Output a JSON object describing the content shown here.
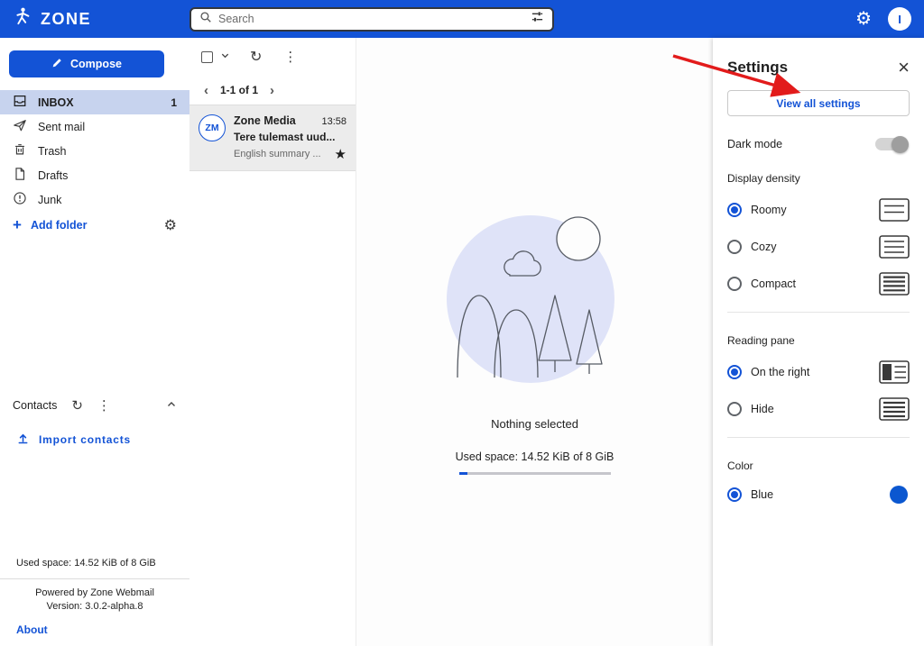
{
  "colors": {
    "brand_blue": "#1353d6",
    "selection_blue": "#c7d3ee",
    "illustration_lavender": "#dfe3f8",
    "accent_blue": "#0b57d0",
    "annotation_red": "#e21b1b"
  },
  "topbar": {
    "brand": "ZONE",
    "search_placeholder": "Search",
    "avatar_initial": "I"
  },
  "sidebar": {
    "compose_label": "Compose",
    "folders": [
      {
        "label": "INBOX",
        "count": "1",
        "selected": true
      },
      {
        "label": "Sent mail"
      },
      {
        "label": "Trash"
      },
      {
        "label": "Drafts"
      },
      {
        "label": "Junk"
      }
    ],
    "add_folder_label": "Add folder",
    "contacts_label": "Contacts",
    "import_contacts_label": "Import contacts",
    "used_space": "Used space: 14.52 KiB of 8 GiB",
    "powered_by": "Powered by Zone Webmail",
    "version": "Version: 3.0.2-alpha.8",
    "about_label": "About"
  },
  "message_list": {
    "pagination": "1-1 of 1",
    "emails": [
      {
        "avatar": "ZM",
        "sender": "Zone Media",
        "time": "13:58",
        "subject": "Tere tulemast uud...",
        "snippet": "English summary ..."
      }
    ]
  },
  "main": {
    "nothing_selected": "Nothing selected",
    "used_space": "Used space: 14.52 KiB of 8 GiB"
  },
  "settings": {
    "title": "Settings",
    "view_all_label": "View all settings",
    "dark_mode_label": "Dark mode",
    "display_density_label": "Display density",
    "density_options": [
      {
        "label": "Roomy",
        "selected": true
      },
      {
        "label": "Cozy",
        "selected": false
      },
      {
        "label": "Compact",
        "selected": false
      }
    ],
    "reading_pane_label": "Reading pane",
    "reading_pane_options": [
      {
        "label": "On the right",
        "selected": true
      },
      {
        "label": "Hide",
        "selected": false
      }
    ],
    "color_label": "Color",
    "color_options": [
      {
        "label": "Blue",
        "selected": true
      }
    ]
  }
}
